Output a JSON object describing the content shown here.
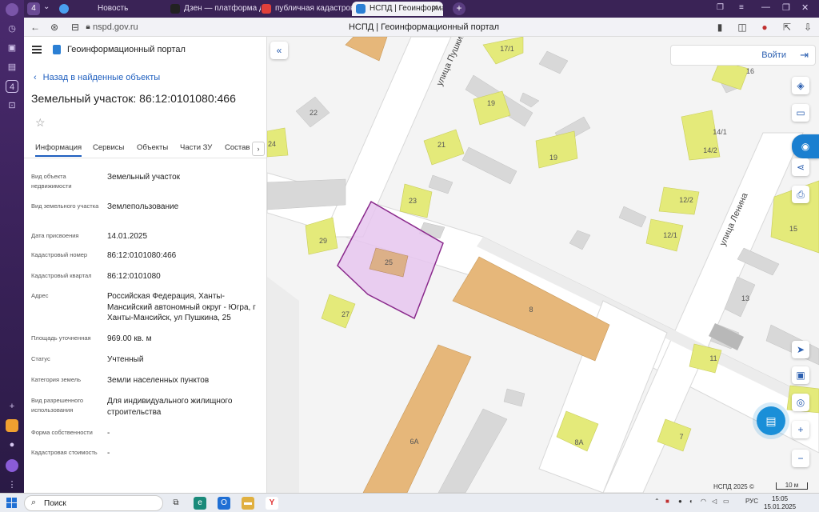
{
  "browser": {
    "tab_counter": "4",
    "tabs": [
      {
        "label": "Новость",
        "active": false
      },
      {
        "label": "Дзен — платформа для п",
        "active": false
      },
      {
        "label": "публичная кадастровая к",
        "active": false
      },
      {
        "label": "НСПД | Геоинформац",
        "active": true
      }
    ],
    "url": "nspd.gov.ru",
    "page_title": "НСПД | Геоинформационный портал"
  },
  "panel": {
    "portal_title": "Геоинформационный портал",
    "back_label": "Назад в найденные объекты",
    "object_title": "Земельный участок: 86:12:0101080:466",
    "tabs": [
      "Информация",
      "Сервисы",
      "Объекты",
      "Части ЗУ",
      "Состав"
    ],
    "fields": [
      {
        "label": "Вид объекта недвижимости",
        "value": "Земельный участок"
      },
      {
        "label": "Вид земельного участка",
        "value": "Землепользование"
      },
      {
        "label": "Дата присвоения",
        "value": "14.01.2025"
      },
      {
        "label": "Кадастровый номер",
        "value": "86:12:0101080:466"
      },
      {
        "label": "Кадастровый квартал",
        "value": "86:12:0101080"
      },
      {
        "label": "Адрес",
        "value": "Российская Федерация, Ханты-Мансийский автономный округ - Югра, г Ханты-Мансийск, ул Пушкина, 25"
      },
      {
        "label": "Площадь уточненная",
        "value": "969.00 кв. м"
      },
      {
        "label": "Статус",
        "value": "Учтенный"
      },
      {
        "label": "Категория земель",
        "value": "Земли населенных пунктов"
      },
      {
        "label": "Вид разрешенного использования",
        "value": "Для индивидуального жилищного строительства"
      },
      {
        "label": "Форма собственности",
        "value": "-"
      },
      {
        "label": "Кадастровая стоимость",
        "value": "-"
      }
    ]
  },
  "map": {
    "login_label": "Войти",
    "streets": [
      "улица Пушкина",
      "улица Ленина"
    ],
    "plot_numbers": [
      "17/1",
      "16",
      "22",
      "19",
      "24",
      "21",
      "19",
      "14/1",
      "14/2",
      "23",
      "12/2",
      "29",
      "25",
      "12/1",
      "15",
      "8",
      "13",
      "27",
      "11",
      "6А",
      "8А",
      "7"
    ],
    "copyright": "НСПД 2025 ©",
    "scale": "10 м",
    "colors": {
      "parcel_selected": "#e6c6ee",
      "parcel_border": "#8a2a8c",
      "building_yellow": "#e4ea7a",
      "building_orange": "#e6b77a",
      "building_gray": "#d8d8d8"
    }
  },
  "taskbar": {
    "search_label": "Поиск",
    "lang": "РУС",
    "time": "15:05",
    "date": "15.01.2025"
  }
}
